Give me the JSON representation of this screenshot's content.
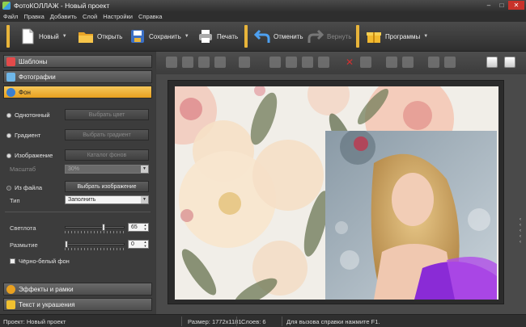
{
  "window": {
    "title": "ФотоКОЛЛАЖ - Новый проект"
  },
  "menu": [
    "Файл",
    "Правка",
    "Добавить",
    "Слой",
    "Настройки",
    "Справка"
  ],
  "toolbar": {
    "new_label": "Новый",
    "open_label": "Открыть",
    "save_label": "Сохранить",
    "print_label": "Печать",
    "undo_label": "Отменить",
    "redo_label": "Вернуть",
    "programs_label": "Программы"
  },
  "sidebar": {
    "templates": "Шаблоны",
    "photos": "Фотографии",
    "background": "Фон",
    "effects": "Эффекты и рамки",
    "text": "Текст и украшения"
  },
  "background_panel": {
    "solid_label": "Однотонный",
    "choose_color": "Выбрать цвет",
    "gradient_label": "Градиент",
    "choose_gradient": "Выбрать градиент",
    "image_label": "Изображение",
    "bg_catalog": "Каталог фонов",
    "scale_label": "Масштаб",
    "scale_value": "30%",
    "from_file_label": "Из файла",
    "choose_image": "Выбрать изображение",
    "type_label": "Тип",
    "type_value": "Заполнить",
    "brightness_label": "Светлота",
    "brightness_value": "65",
    "brightness_level": 0.65,
    "blur_label": "Размытие",
    "blur_value": "0",
    "blur_level": 0,
    "bw_label": "Чёрно-белый фон"
  },
  "status": {
    "project": "Проект: Новый проект",
    "size": "Размер: 1772x1181",
    "layers": "Слоев: 6",
    "help": "Для вызова справки нажмите F1."
  },
  "colors": {
    "accent": "#f0b030",
    "close": "#c8322a"
  },
  "icons": [
    "new-doc-icon",
    "folder-icon",
    "save-icon",
    "printer-icon",
    "undo-icon",
    "redo-icon",
    "gift-box-icon"
  ]
}
